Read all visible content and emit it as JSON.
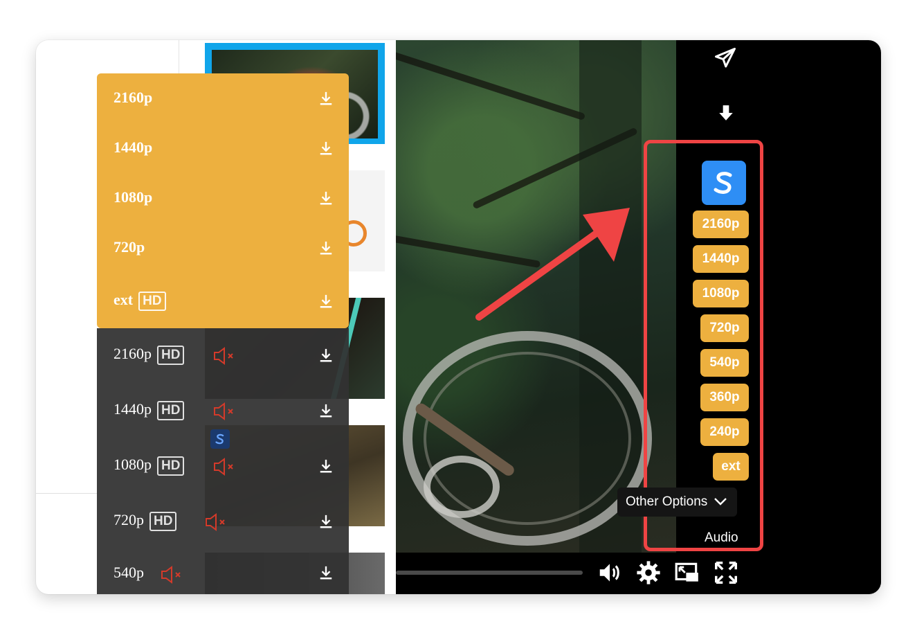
{
  "dropdown": {
    "items": [
      {
        "label": "2160p"
      },
      {
        "label": "1440p"
      },
      {
        "label": "1080p"
      },
      {
        "label": "720p"
      },
      {
        "label": "ext",
        "badge": "HD"
      }
    ]
  },
  "dark_list": {
    "items": [
      {
        "label": "2160p",
        "badge": "HD"
      },
      {
        "label": "1440p",
        "badge": "HD"
      },
      {
        "label": "1080p",
        "badge": "HD"
      },
      {
        "label": "720p",
        "badge": "HD"
      },
      {
        "label": "540p"
      }
    ]
  },
  "player": {
    "quality_buttons": [
      "2160p",
      "1440p",
      "1080p",
      "720p",
      "540p",
      "360p",
      "240p",
      "ext"
    ],
    "other_options_label": "Other Options",
    "audio_label": "Audio"
  },
  "colors": {
    "accent_orange": "#edb03f",
    "highlight_red": "#ef4444",
    "logo_blue": "#2e8ef5",
    "thumb_selected_blue": "#10a5ea"
  },
  "icons": [
    "send-icon",
    "download-icon",
    "volume-icon",
    "settings-icon",
    "miniplayer-icon",
    "fullscreen-icon",
    "muted-icon",
    "chevron-down-icon"
  ]
}
